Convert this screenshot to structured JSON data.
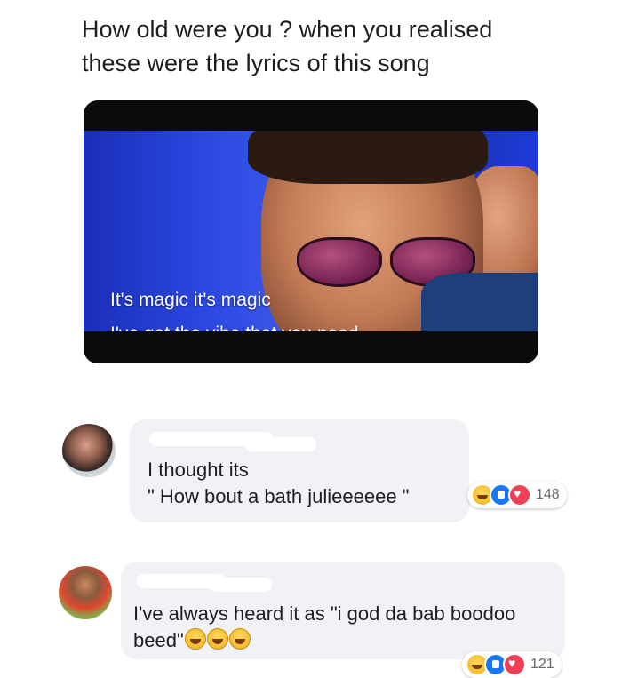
{
  "post": {
    "caption_line1": "How old were you ? when you realised",
    "caption_line2": "these were the lyrics of this song"
  },
  "meme": {
    "lyric_line1": "It's magic it's magic",
    "lyric_line2": "I've got the vibe that you need"
  },
  "comments": [
    {
      "author_redacted": true,
      "text_line1": "I thought its",
      "text_line2": "\" How bout a bath julieeeeee \"",
      "reactions": [
        "haha-icon",
        "like-icon",
        "love-icon"
      ],
      "reaction_count": "148"
    },
    {
      "author_redacted": true,
      "text_line1": "I've always heard it as \"i god da bab boodoo",
      "text_line2": "beed\"",
      "inline_emojis": [
        "laughing-tears-icon",
        "laughing-tears-icon",
        "laughing-tears-icon"
      ],
      "reactions": [
        "haha-icon",
        "like-icon",
        "love-icon"
      ],
      "reaction_count": "121"
    }
  ],
  "colors": {
    "bubble_bg": "#f0f2f5",
    "like_blue": "#1877f2",
    "love_red": "#f33e58",
    "haha_yellow": "#f2b01e"
  }
}
